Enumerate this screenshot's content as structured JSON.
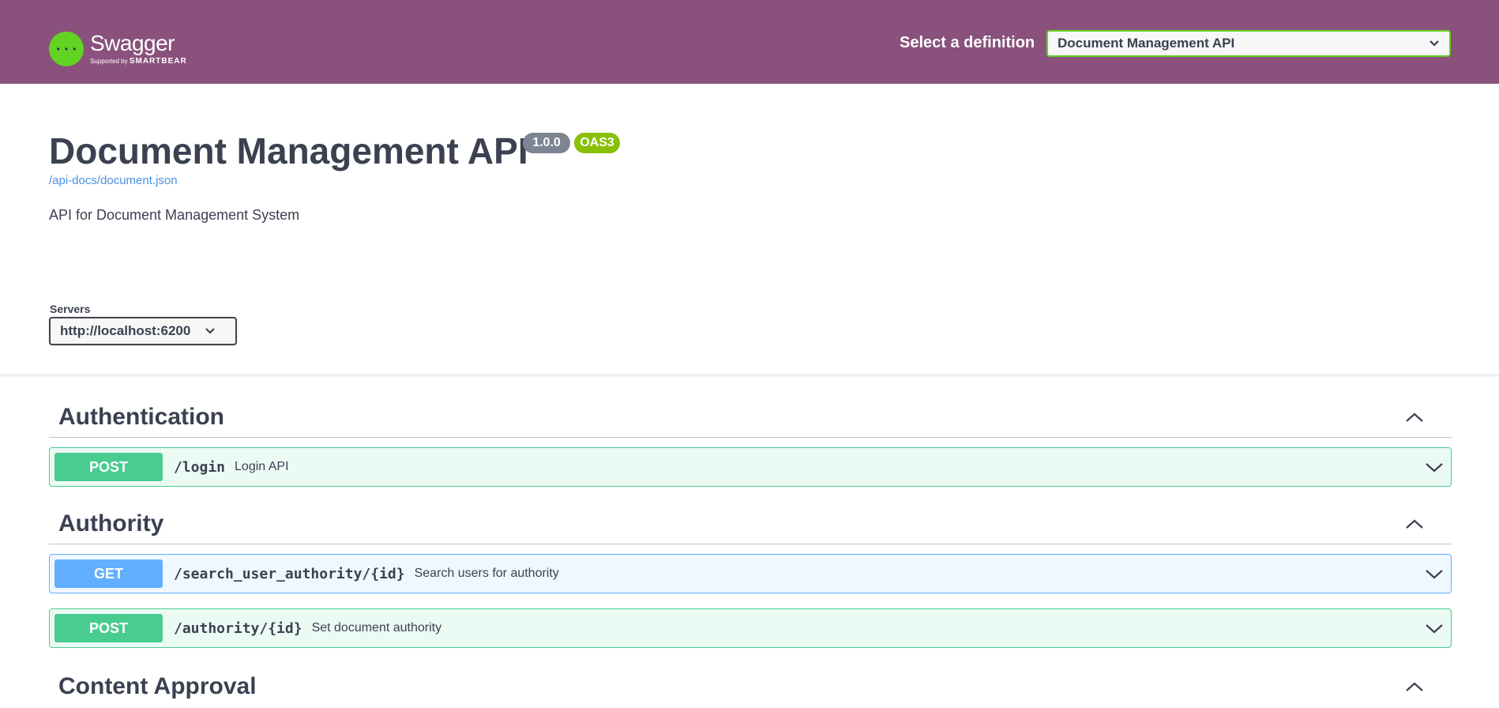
{
  "topbar": {
    "logo_title": "Swagger",
    "logo_supported": "Supported by",
    "logo_brand": "SMARTBEAR",
    "definition_label": "Select a definition",
    "definition_selected": "Document Management API",
    "background_color": "#89517c",
    "logo_color": "#62d321"
  },
  "info": {
    "title": "Document Management API",
    "version": "1.0.0",
    "oas": "OAS3",
    "link": "/api-docs/document.json",
    "description": "API for Document Management System"
  },
  "servers": {
    "label": "Servers",
    "selected": "http://localhost:6200"
  },
  "tags": [
    {
      "name": "Authentication",
      "operations": [
        {
          "method": "POST",
          "path": "/login",
          "summary": "Login API"
        }
      ]
    },
    {
      "name": "Authority",
      "operations": [
        {
          "method": "GET",
          "path": "/search_user_authority/{id}",
          "summary": "Search users for authority"
        },
        {
          "method": "POST",
          "path": "/authority/{id}",
          "summary": "Set document authority"
        }
      ]
    },
    {
      "name": "Content Approval",
      "operations": []
    }
  ],
  "colors": {
    "post": "#49cc90",
    "get": "#61affe",
    "text": "#3b4151"
  }
}
